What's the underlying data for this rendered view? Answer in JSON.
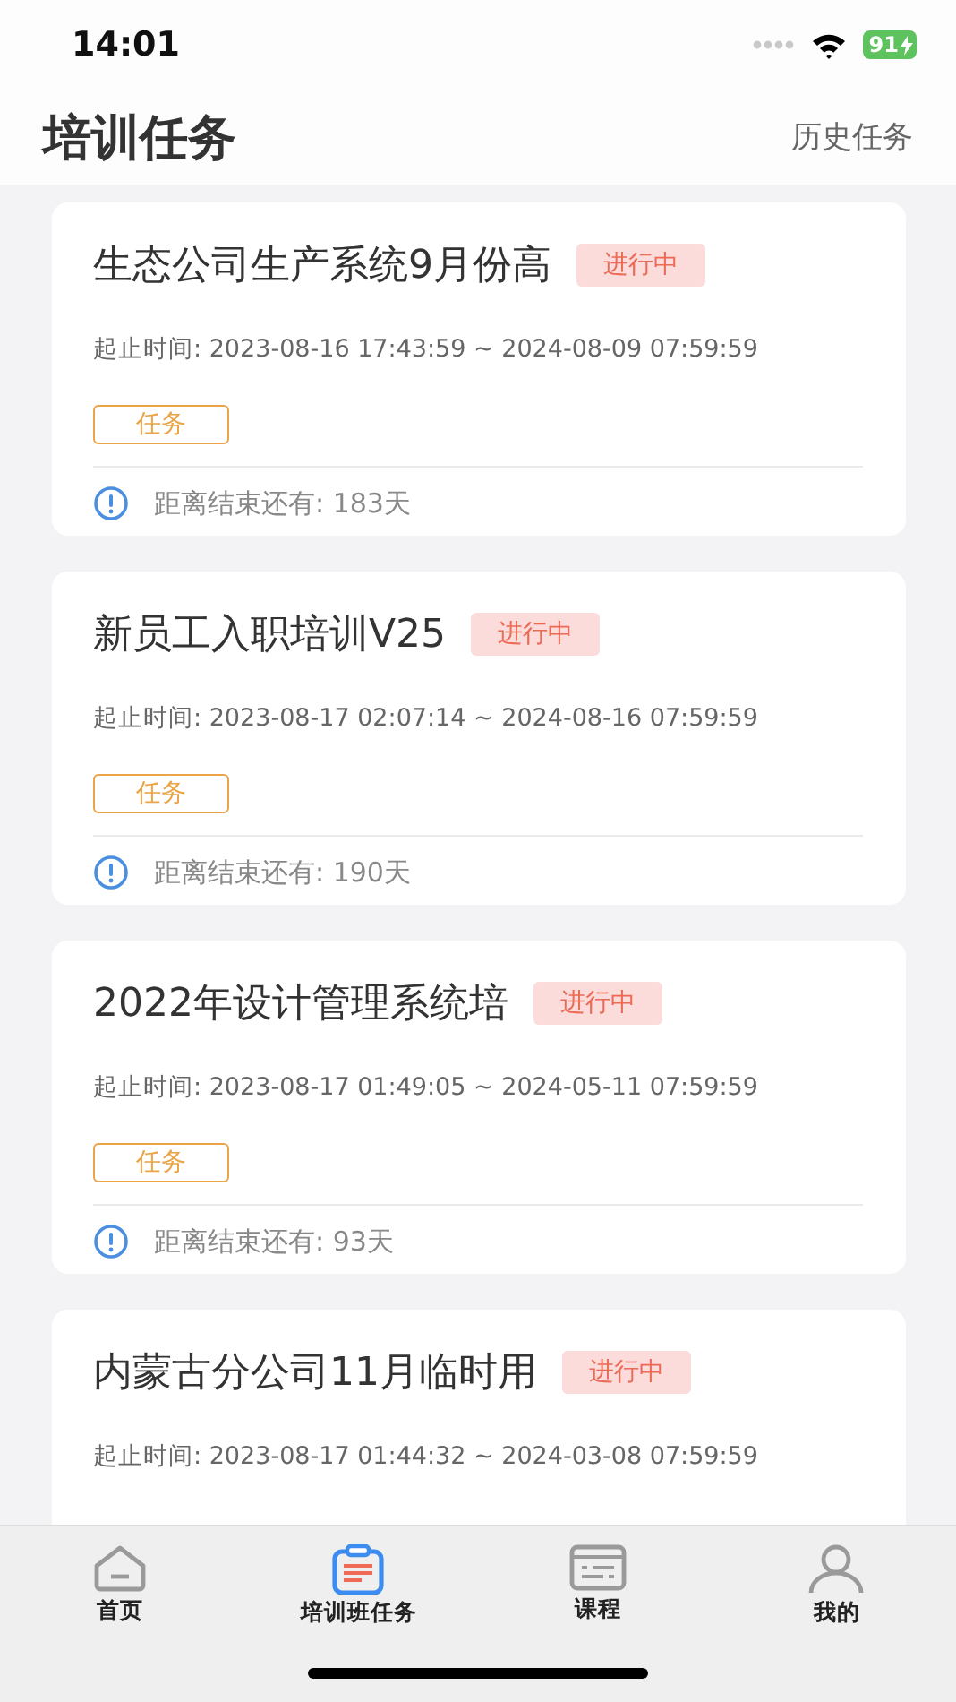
{
  "status_bar": {
    "time": "14:01",
    "battery": "91"
  },
  "header": {
    "title": "培训任务",
    "action": "历史任务"
  },
  "tasks": [
    {
      "title": "生态公司生产系统9月份高",
      "status": "进行中",
      "period": "起止时间: 2023-08-16 17:43:59 ~ 2024-08-09 07:59:59",
      "tag": "任务",
      "remaining": "距离结束还有: 183天"
    },
    {
      "title": "新员工入职培训V25",
      "status": "进行中",
      "period": "起止时间: 2023-08-17 02:07:14 ~ 2024-08-16 07:59:59",
      "tag": "任务",
      "remaining": "距离结束还有: 190天"
    },
    {
      "title": "2022年设计管理系统培",
      "status": "进行中",
      "period": "起止时间: 2023-08-17 01:49:05 ~ 2024-05-11 07:59:59",
      "tag": "任务",
      "remaining": "距离结束还有: 93天"
    },
    {
      "title": "内蒙古分公司11月临时用",
      "status": "进行中",
      "period": "起止时间: 2023-08-17 01:44:32 ~ 2024-03-08 07:59:59"
    }
  ],
  "tab_bar": [
    {
      "kind": "home",
      "label": "首页",
      "selected": false
    },
    {
      "kind": "tasks",
      "label": "培训班任务",
      "selected": true
    },
    {
      "kind": "course",
      "label": "课程",
      "selected": false
    },
    {
      "kind": "me",
      "label": "我的",
      "selected": false
    }
  ]
}
